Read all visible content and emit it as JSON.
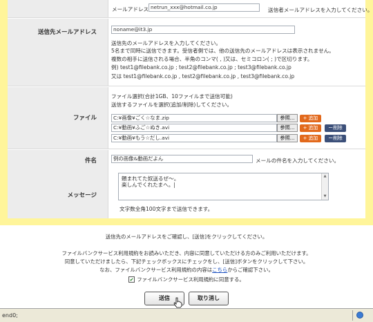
{
  "sender": {
    "email_label": "メールアドレス",
    "email_value": "netrun_xxx@hotmail.co.jp",
    "email_hint": "送信者メールアドレスを入力してください。"
  },
  "recipient": {
    "label": "送信先メールアドレス",
    "value": "noname@it3.jp",
    "help": [
      "送信先のメールアドレスを入力してください。",
      "5名まで同時に送信できます。受信者側では、他の送信先のメールアドレスは表示されません。",
      "複数の相手に送信される場合、半角のコンマ( , )又は、セミコロン( ; )で区切ります。",
      "例) test1@filebank.co.jp ; test2@filebank.co.jp ; test3@filebank.co.jp",
      "又は test1@filebank.co.jp , test2@filebank.co.jp , test3@filebank.co.jp"
    ]
  },
  "files": {
    "label": "ファイル",
    "note1": "ファイル選択(合計1GB、10ファイルまで送信可能)",
    "note2": "送信するファイルを選択(追加/削除)してください。",
    "items": [
      {
        "path": "C:¥画像¥ごく☆なま.zip",
        "browse": "参照...",
        "add": "+ 追加",
        "remove": ""
      },
      {
        "path": "C:¥動画¥ふご☆ぬき.avi",
        "browse": "参照...",
        "add": "+ 追加",
        "remove": "ー削除"
      },
      {
        "path": "C:¥動画¥もう☆だし.avi",
        "browse": "参照...",
        "add": "+ 追加",
        "remove": "ー削除"
      }
    ]
  },
  "subject": {
    "label": "件名",
    "value": "例の画像&動画だよん",
    "hint": "メールの件名を入力してください。"
  },
  "message": {
    "label": "メッセージ",
    "line1": "頼まれてた奴送るぜ〜。",
    "line2": "楽しんでくれたまへ。|",
    "limit": "文字数全角100文字まで送信できます。"
  },
  "footer": {
    "confirm": "送信先のメールアドレスをご確認し、[送信]をクリックしてください。",
    "terms1": "ファイルバンクサービス利用規約をお読みいただき、内容に同意していただける方のみご利用いただけます。",
    "terms2": "同意していただけましたら、下記チェックボックスにチェックをし、[送信]ボタンをクリックして下さい。",
    "terms3_pre": "なお、ファイルバンクサービス利用規約の内容は",
    "terms3_link": "こちら",
    "terms3_post": "からご確認下さい。",
    "agree_label": "ファイルバンクサービス利用規約に同意する。",
    "agree_checked": "✔",
    "send_button": "送信",
    "cancel_button": "取り消し"
  },
  "statusbar": {
    "left": "end0;"
  },
  "colors": {
    "frame": "#fff59a",
    "label_bg": "#ececec",
    "add_button": "#e2691c",
    "remove_button": "#3b4f79",
    "link": "#1a4fbf"
  }
}
